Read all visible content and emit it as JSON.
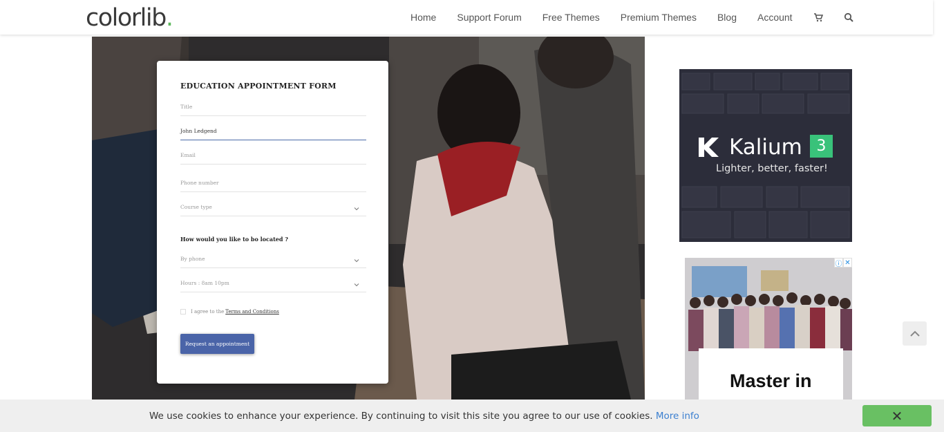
{
  "header": {
    "logo_text": "colorlib",
    "logo_dot": ".",
    "nav": [
      "Home",
      "Support Forum",
      "Free Themes",
      "Premium Themes",
      "Blog",
      "Account"
    ],
    "icons": [
      "cart-icon",
      "search-icon"
    ]
  },
  "form": {
    "title": "EDUCATION APPOINTMENT FORM",
    "fields": [
      {
        "placeholder": "Title",
        "value": ""
      },
      {
        "placeholder": "",
        "value": "John Ledgend"
      },
      {
        "placeholder": "Email",
        "value": ""
      },
      {
        "placeholder": "Phone number",
        "value": ""
      }
    ],
    "course_select": "Course type",
    "question": "How would you like to bo located ?",
    "contact_select": "By phone",
    "hours_select": "Hours : 8am 10pm",
    "agree_prefix": "I agree to the",
    "agree_link": "Terms and Conditions",
    "submit_label": "Request an appointment"
  },
  "ad_kalium": {
    "name": "Kalium",
    "version": "3",
    "tagline": "Lighter, better, faster!",
    "accent": "#39c27a"
  },
  "ad_master": {
    "heading": "Master in"
  },
  "cookie_bar": {
    "message": "We use cookies to enhance your experience. By continuing to visit this site you agree to our use of cookies.",
    "more_info": "More info",
    "close_label": "✕",
    "close_color": "#69c063"
  }
}
